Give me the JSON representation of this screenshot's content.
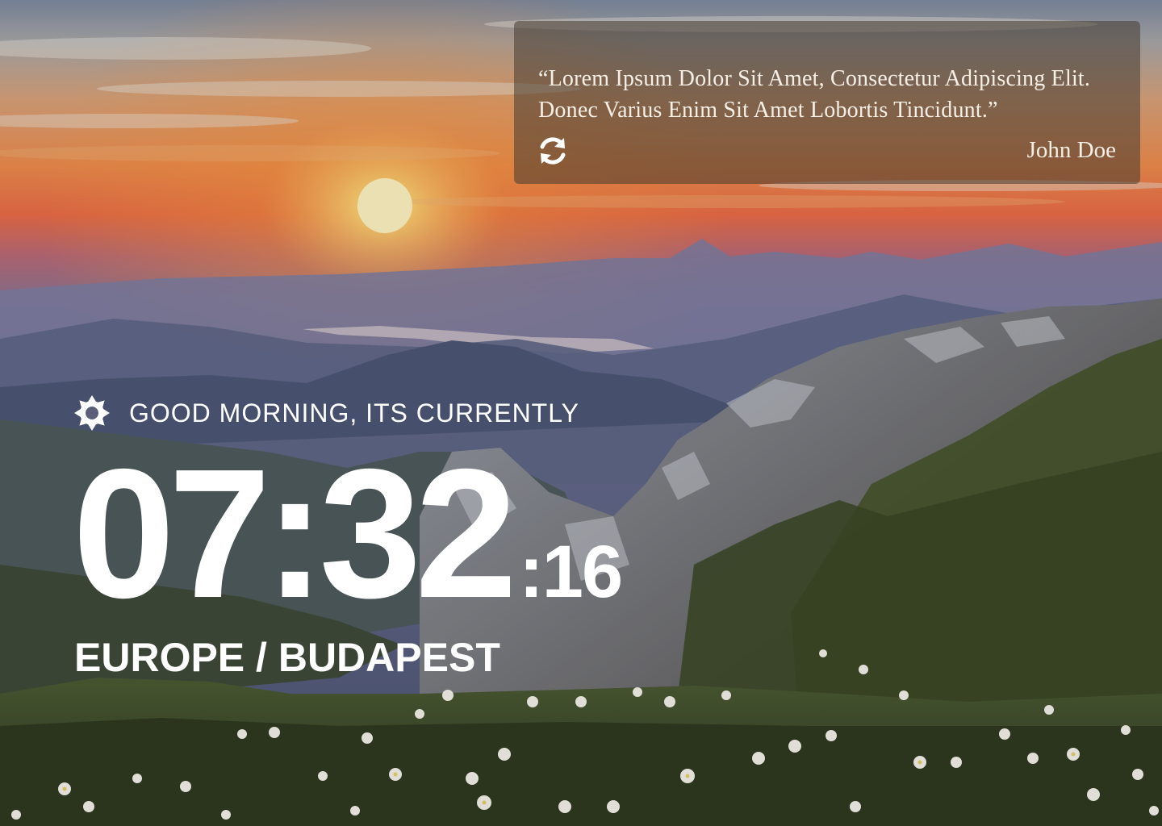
{
  "quote": {
    "text": "“Lorem Ipsum Dolor Sit Amet, Consectetur Adipiscing Elit. Donec Varius Enim Sit Amet Lobortis Tincidunt.”",
    "author": "John Doe",
    "refresh_icon": "refresh-icon"
  },
  "greeting": {
    "icon": "sun-icon",
    "text": "GOOD MORNING, ITS CURRENTLY"
  },
  "clock": {
    "hours_minutes": "07:32",
    "seconds": ":16"
  },
  "location": {
    "text": "EUROPE / BUDAPEST"
  },
  "colors": {
    "card_background": "#463a30",
    "text": "#ffffff"
  }
}
